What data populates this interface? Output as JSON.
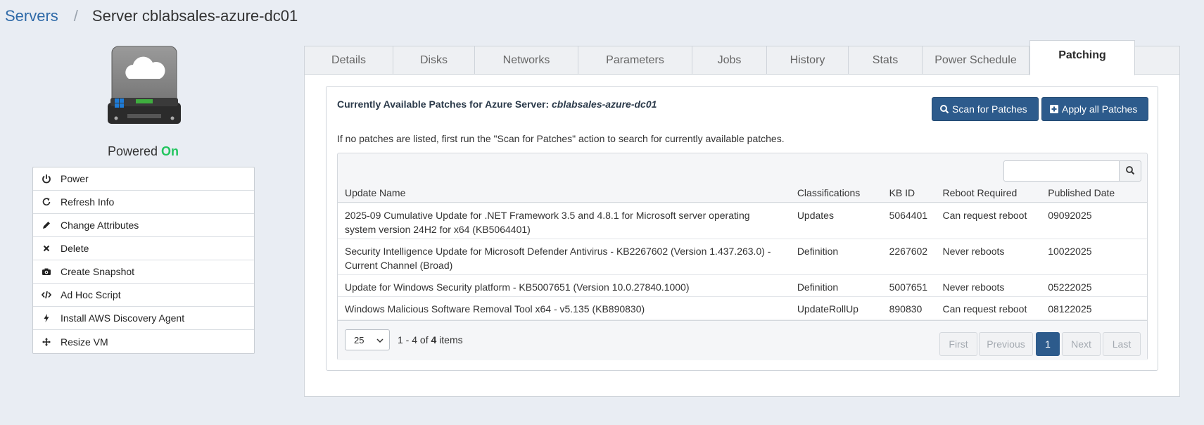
{
  "breadcrumb": {
    "root": "Servers",
    "separator": "/",
    "current": "Server cblabsales-azure-dc01"
  },
  "server": {
    "power_label": "Powered",
    "power_state": "On",
    "power_color": "#22c55e"
  },
  "actions": [
    {
      "label": "Power",
      "icon": "power-icon"
    },
    {
      "label": "Refresh Info",
      "icon": "refresh-icon"
    },
    {
      "label": "Change Attributes",
      "icon": "pencil-icon"
    },
    {
      "label": "Delete",
      "icon": "close-icon"
    },
    {
      "label": "Create Snapshot",
      "icon": "camera-icon"
    },
    {
      "label": "Ad Hoc Script",
      "icon": "code-icon"
    },
    {
      "label": "Install AWS Discovery Agent",
      "icon": "bolt-icon"
    },
    {
      "label": "Resize VM",
      "icon": "move-icon"
    }
  ],
  "tabs": [
    "Details",
    "Disks",
    "Networks",
    "Parameters",
    "Jobs",
    "History",
    "Stats",
    "Power Schedule",
    "Patching"
  ],
  "active_tab": "Patching",
  "patching": {
    "title": "Currently Available Patches for Azure Server: ",
    "server_name": "cblabsales-azure-dc01",
    "scan_label": "Scan for Patches",
    "apply_label": "Apply all Patches",
    "info": "If no patches are listed, first run the \"Scan for Patches\" action to search for currently available patches.",
    "columns": [
      "Update Name",
      "Classifications",
      "KB ID",
      "Reboot Required",
      "Published Date"
    ],
    "rows": [
      {
        "name": "2025-09 Cumulative Update for .NET Framework 3.5 and 4.8.1 for Microsoft server operating system version 24H2 for x64 (KB5064401)",
        "classification": "Updates",
        "kb": "5064401",
        "reboot": "Can request reboot",
        "date": "09092025"
      },
      {
        "name": "Security Intelligence Update for Microsoft Defender Antivirus - KB2267602 (Version 1.437.263.0) - Current Channel (Broad)",
        "classification": "Definition",
        "kb": "2267602",
        "reboot": "Never reboots",
        "date": "10022025"
      },
      {
        "name": "Update for Windows Security platform - KB5007651 (Version 10.0.27840.1000)",
        "classification": "Definition",
        "kb": "5007651",
        "reboot": "Never reboots",
        "date": "05222025"
      },
      {
        "name": "Windows Malicious Software Removal Tool x64 - v5.135 (KB890830)",
        "classification": "UpdateRollUp",
        "kb": "890830",
        "reboot": "Can request reboot",
        "date": "08122025"
      }
    ],
    "pager": {
      "page_size": "25",
      "range": "1 - 4 of ",
      "total": "4",
      "items_suffix": " items",
      "first": "First",
      "previous": "Previous",
      "current": "1",
      "next": "Next",
      "last": "Last"
    }
  },
  "colors": {
    "accent": "#2d5b8c",
    "link": "#2f6aa8"
  }
}
